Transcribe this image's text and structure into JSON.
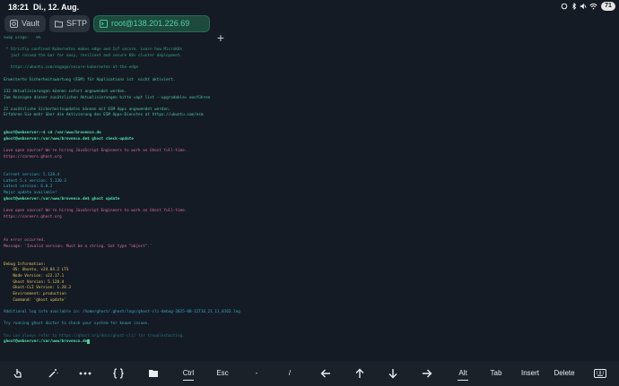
{
  "status_bar": {
    "time": "18:21",
    "date": "Di., 12. Aug.",
    "battery": "71"
  },
  "tabs": [
    {
      "label": "Vault",
      "icon": "vault-icon"
    },
    {
      "label": "SFTP",
      "icon": "folder-icon"
    },
    {
      "label": "root@138.201.226.69",
      "icon": "terminal-icon",
      "active": true
    }
  ],
  "new_tab_label": "+",
  "terminal_lines": [
    {
      "text": "Swap usage:   0%",
      "color": "dgreen"
    },
    {
      "text": "",
      "color": "dgreen"
    },
    {
      "text": " * Strictly confined Kubernetes makes edge and IoT secure. Learn how MicroK8s",
      "color": "dgreen"
    },
    {
      "text": "   just raised the bar for easy, resilient and secure K8s cluster deployment.",
      "color": "dgreen"
    },
    {
      "text": "",
      "color": "dgreen"
    },
    {
      "text": "   https://ubuntu.com/engage/secure-kubernetes-at-the-edge",
      "color": "dgreen"
    },
    {
      "text": "",
      "color": "dgreen"
    },
    {
      "text": "Erweiterte Sicherheitswartung (ESM) für Applications ist  nicht aktiviert.",
      "color": "green"
    },
    {
      "text": "",
      "color": "green"
    },
    {
      "text": "132 Aktualisierungen können sofort angewendet werden.",
      "color": "green"
    },
    {
      "text": "Zum Anzeigen dieser zusätzlichen Aktualisierungen bitte »apt list --upgradable« ausführen",
      "color": "green"
    },
    {
      "text": "",
      "color": "green"
    },
    {
      "text": "22 zusätzliche Sicherheitsupdates können mit ESM Apps angewendet werden.",
      "color": "green"
    },
    {
      "text": "Erfahren Sie mehr über die Aktivierung des ESM Apps-Dienstes at https://ubuntu.com/esm",
      "color": "green"
    },
    {
      "text": "",
      "color": "green"
    },
    {
      "text": "",
      "color": "green"
    },
    {
      "text": "ghost@webserver:~$ cd /var/www/brovenco.de",
      "color": "bright"
    },
    {
      "text": "ghost@webserver:/var/www/brovenco.de$ ghost check-update",
      "color": "bright"
    },
    {
      "text": "",
      "color": "green"
    },
    {
      "text": "Love open source? We're hiring JavaScript Engineers to work on Ghost full-time.",
      "color": "pink"
    },
    {
      "text": "https://careers.ghost.org",
      "color": "pink"
    },
    {
      "text": "",
      "color": "green"
    },
    {
      "text": "",
      "color": "green"
    },
    {
      "text": "Current version: 5.128.4",
      "color": "blue"
    },
    {
      "text": "Latest 5.x version: 5.130.3",
      "color": "blue"
    },
    {
      "text": "Latest version: 6.0.2",
      "color": "blue"
    },
    {
      "text": "Major update available!",
      "color": "blue"
    },
    {
      "text": "ghost@webserver:/var/www/brovenco.de$ ghost update",
      "color": "bright"
    },
    {
      "text": "",
      "color": "green"
    },
    {
      "text": "Love open source? We're hiring JavaScript Engineers to work on Ghost full-time.",
      "color": "pink"
    },
    {
      "text": "https://careers.ghost.org",
      "color": "pink"
    },
    {
      "text": "",
      "color": "green"
    },
    {
      "text": "",
      "color": "green"
    },
    {
      "text": "",
      "color": "green"
    },
    {
      "text": "An error occurred.",
      "color": "pink"
    },
    {
      "text": "Message: 'Invalid version. Must be a string. Got type \"object\".'",
      "color": "pink"
    },
    {
      "text": "",
      "color": "green"
    },
    {
      "text": "",
      "color": "green"
    },
    {
      "text": "Debug Information:",
      "color": "yellow"
    },
    {
      "text": "    OS: Ubuntu, v24.04.2 LTS",
      "color": "yellow"
    },
    {
      "text": "    Node Version: v22.17.1",
      "color": "yellow"
    },
    {
      "text": "    Ghost Version: 5.128.4",
      "color": "yellow"
    },
    {
      "text": "    Ghost-CLI Version: 1.28.3",
      "color": "yellow"
    },
    {
      "text": "    Environment: production",
      "color": "yellow"
    },
    {
      "text": "    Command: 'ghost update'",
      "color": "yellow"
    },
    {
      "text": "",
      "color": "green"
    },
    {
      "text": "Additional log info available in: /home/ghost/.ghost/logs/ghost-cli-debug-2025-08-12T16_21_11_0162.log",
      "color": "blue"
    },
    {
      "text": "",
      "color": "green"
    },
    {
      "text": "Try running ghost doctor to check your system for known issues.",
      "color": "blue"
    },
    {
      "text": "",
      "color": "green"
    },
    {
      "text": "You can always refer to https://ghost.org/docs/ghost-cli/ for troubleshooting.",
      "color": "dim"
    },
    {
      "text": "ghost@webserver:/var/www/brovenco.de$ ",
      "color": "bright"
    }
  ],
  "keybar": {
    "keys": [
      {
        "icon": "touch-icon"
      },
      {
        "icon": "magic-wand-icon"
      },
      {
        "icon": "more-icon"
      },
      {
        "icon": "snippets-icon"
      },
      {
        "icon": "folder-icon"
      },
      {
        "label": "Ctrl"
      },
      {
        "label": "Esc"
      },
      {
        "label": "-"
      },
      {
        "label": "/"
      },
      {
        "icon": "arrow-left-icon"
      },
      {
        "icon": "arrow-up-icon"
      },
      {
        "icon": "arrow-down-icon"
      },
      {
        "icon": "arrow-right-icon"
      },
      {
        "label": "Alt"
      },
      {
        "label": "Tab"
      },
      {
        "label": "Insert"
      },
      {
        "label": "Delete"
      },
      {
        "icon": "keyboard-icon"
      }
    ]
  },
  "colors": {
    "background": "#141b24",
    "accent": "#4fd1a0"
  }
}
